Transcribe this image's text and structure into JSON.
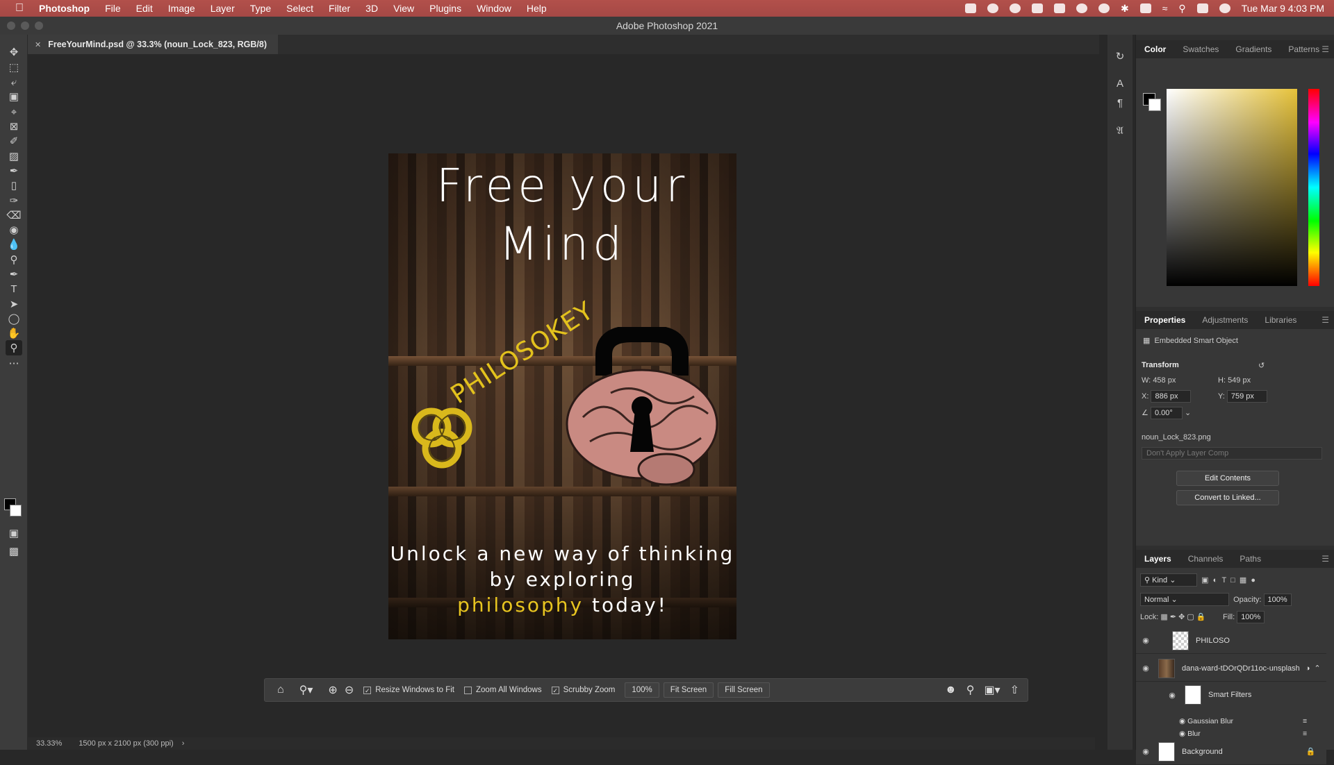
{
  "menubar": {
    "app": "Photoshop",
    "items": [
      "File",
      "Edit",
      "Image",
      "Layer",
      "Type",
      "Select",
      "Filter",
      "3D",
      "View",
      "Plugins",
      "Window",
      "Help"
    ],
    "clock": "Tue Mar 9  4:03 PM"
  },
  "window": {
    "title": "Adobe Photoshop 2021"
  },
  "document": {
    "tab_label": "FreeYourMind.psd @ 33.3% (noun_Lock_823, RGB/8)"
  },
  "poster": {
    "title_line1": "Free your",
    "title_line2": "Mind",
    "brand": "PHILOSOKEY",
    "sub_line1": "Unlock a new way of thinking",
    "sub_line2": "by exploring",
    "sub_highlight": "philosophy",
    "sub_end": " today!"
  },
  "zoom_options": {
    "resize_windows": "Resize Windows to Fit",
    "resize_windows_checked": true,
    "zoom_all": "Zoom All Windows",
    "zoom_all_checked": false,
    "scrubby": "Scrubby Zoom",
    "scrubby_checked": true,
    "zoom_value": "100%",
    "fit_screen": "Fit Screen",
    "fill_screen": "Fill Screen"
  },
  "status": {
    "zoom": "33.33%",
    "doc_info": "1500 px x 2100 px (300 ppi)"
  },
  "color_panel": {
    "tabs": [
      "Color",
      "Swatches",
      "Gradients",
      "Patterns"
    ],
    "active": "Color"
  },
  "properties_panel": {
    "tabs": [
      "Properties",
      "Adjustments",
      "Libraries"
    ],
    "type": "Embedded Smart Object",
    "section": "Transform",
    "w_label": "W:",
    "w": "458 px",
    "h_label": "H:",
    "h": "549 px",
    "x_label": "X:",
    "x": "886 px",
    "y_label": "Y:",
    "y": "759 px",
    "angle": "0.00°",
    "filename": "noun_Lock_823.png",
    "layer_comp": "Don't Apply Layer Comp",
    "edit_contents": "Edit Contents",
    "convert_linked": "Convert to Linked..."
  },
  "layers_panel": {
    "tabs": [
      "Layers",
      "Channels",
      "Paths"
    ],
    "filter": "Kind",
    "blend_mode": "Normal",
    "opacity_label": "Opacity:",
    "opacity": "100%",
    "lock_label": "Lock:",
    "fill_label": "Fill:",
    "fill": "100%",
    "layers": [
      {
        "name": "PHILOSO"
      },
      {
        "name": "dana-ward-tDOrQDr11oc-unsplash"
      },
      {
        "name": "Smart Filters"
      },
      {
        "name": "Gaussian Blur"
      },
      {
        "name": "Blur"
      },
      {
        "name": "Background"
      }
    ]
  }
}
